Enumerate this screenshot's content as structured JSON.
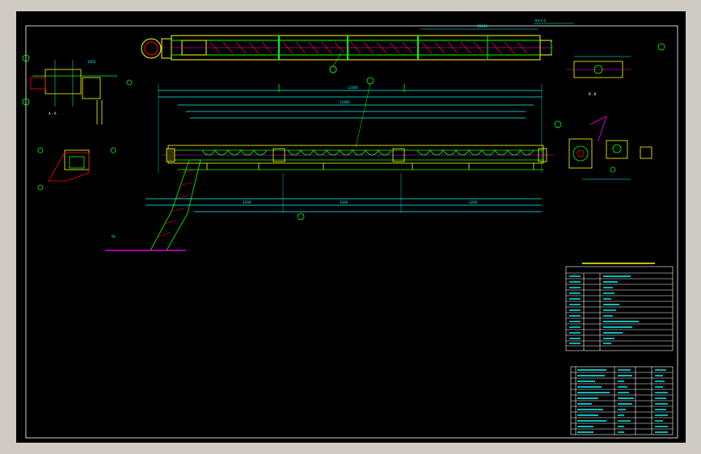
{
  "colors": {
    "background": "#000000",
    "frame": "#cfcbc3",
    "outline": "#ffff00",
    "detail": "#00ff00",
    "dimension": "#00ffff",
    "centerline": "#ff00ff",
    "annotation": "#ffffff",
    "hatch": "#ff0000"
  },
  "sheet_border_color": "#ffffff",
  "spec_table": {
    "title": "",
    "rows": 14
  },
  "parts_list": {
    "rows": 12,
    "cols": 6
  }
}
